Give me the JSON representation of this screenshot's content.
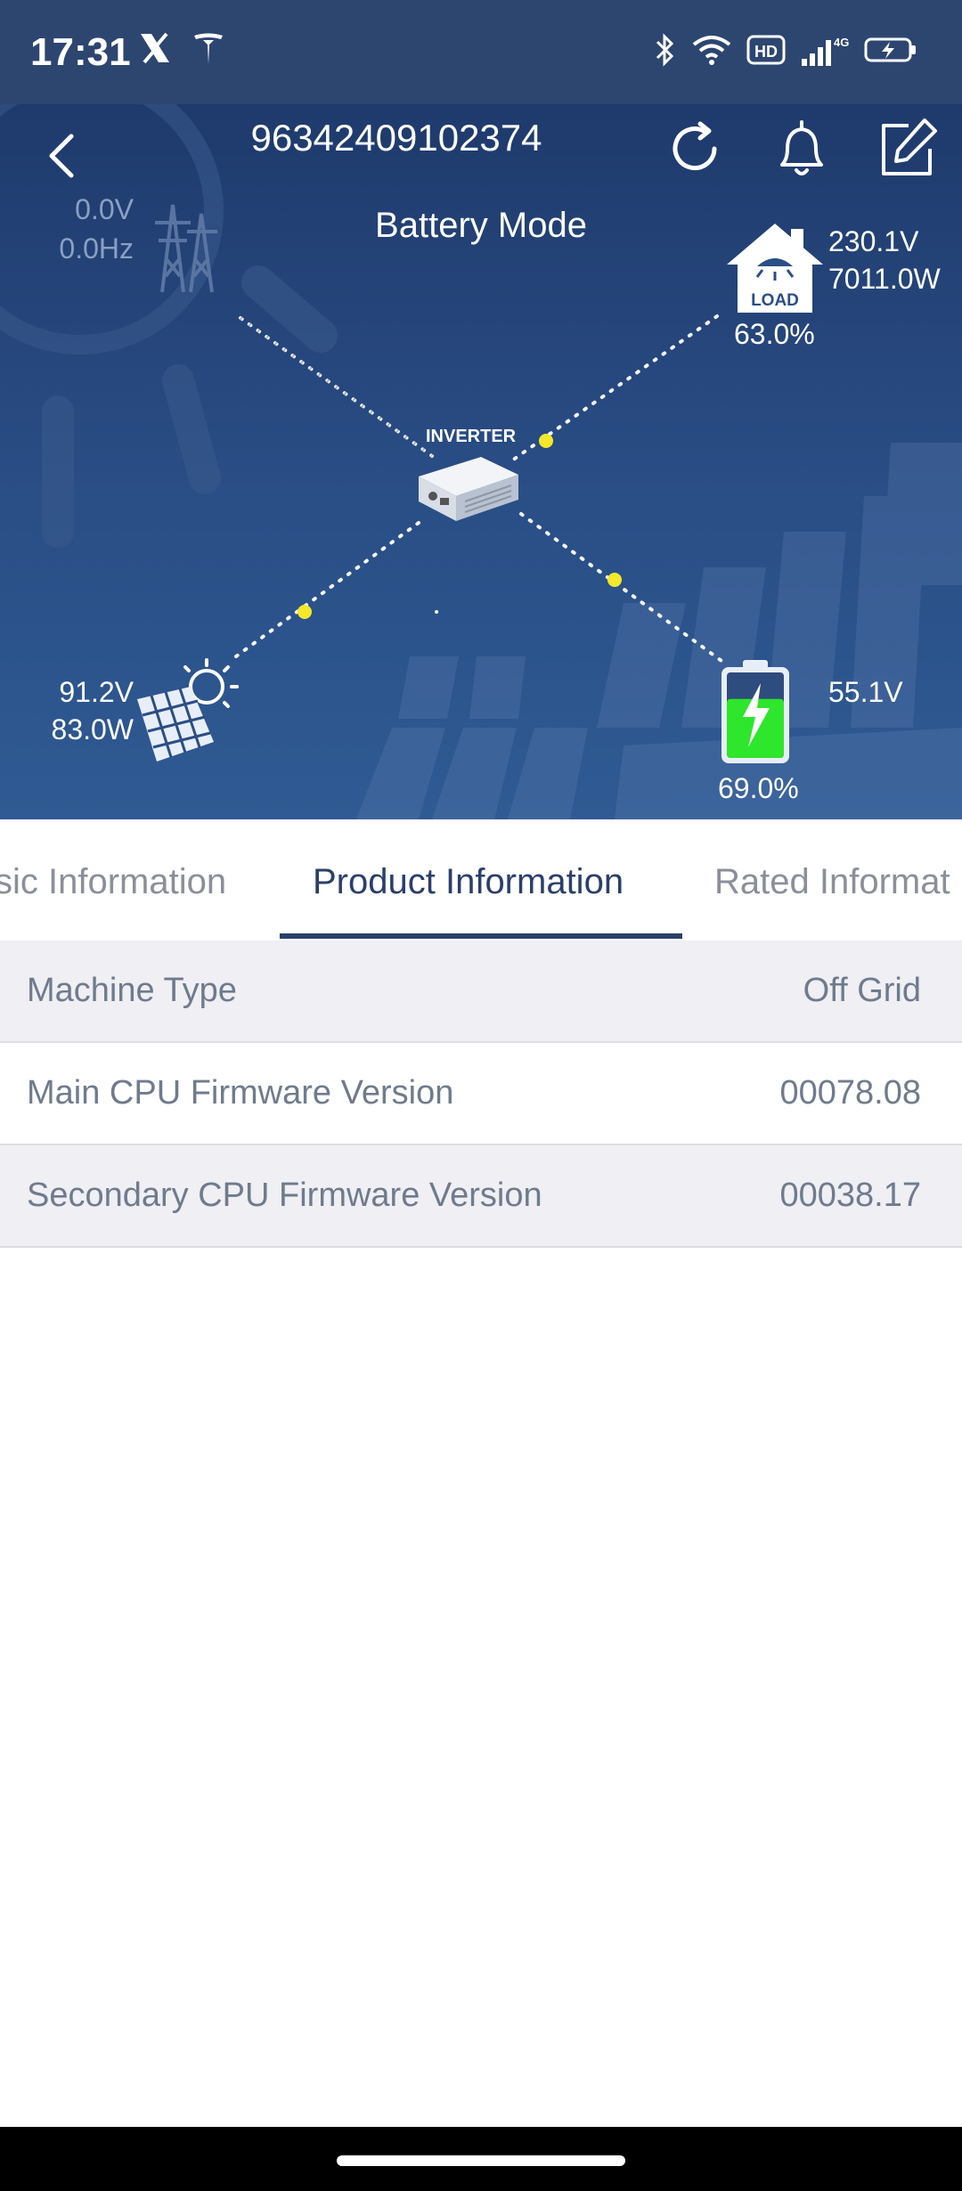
{
  "status_bar": {
    "time": "17:31",
    "left_icons": [
      "x-logo-icon",
      "tesla-logo-icon"
    ],
    "right_icons": [
      "bluetooth-icon",
      "wifi-icon",
      "hd-icon",
      "signal-icon",
      "battery-charging-icon"
    ],
    "hd_label": "HD",
    "network_label": "4G"
  },
  "header": {
    "device_id": "96342409102374",
    "mode": "Battery Mode",
    "icons": [
      "back-icon",
      "refresh-icon",
      "bell-icon",
      "edit-icon"
    ]
  },
  "flow": {
    "grid": {
      "voltage": "0.0V",
      "frequency": "0.0Hz"
    },
    "load": {
      "label": "LOAD",
      "voltage": "230.1V",
      "power": "7011.0W",
      "percent": "63.0%"
    },
    "inverter": {
      "label": "INVERTER"
    },
    "pv": {
      "voltage": "91.2V",
      "power": "83.0W"
    },
    "battery": {
      "voltage": "55.1V",
      "percent": "69.0%",
      "level": 0.69
    },
    "colors": {
      "flow_dot": "#f5e72a",
      "battery_fill": "#2ee62b",
      "hero_bg": "#244172"
    }
  },
  "tabs": {
    "items": [
      "sic Information",
      "Product Information",
      "Rated Informat"
    ],
    "active_index": 1
  },
  "product_info": {
    "rows": [
      {
        "label": "Machine Type",
        "value": "Off Grid"
      },
      {
        "label": "Main CPU Firmware Version",
        "value": "00078.08"
      },
      {
        "label": "Secondary CPU Firmware Version",
        "value": "00038.17"
      }
    ]
  }
}
